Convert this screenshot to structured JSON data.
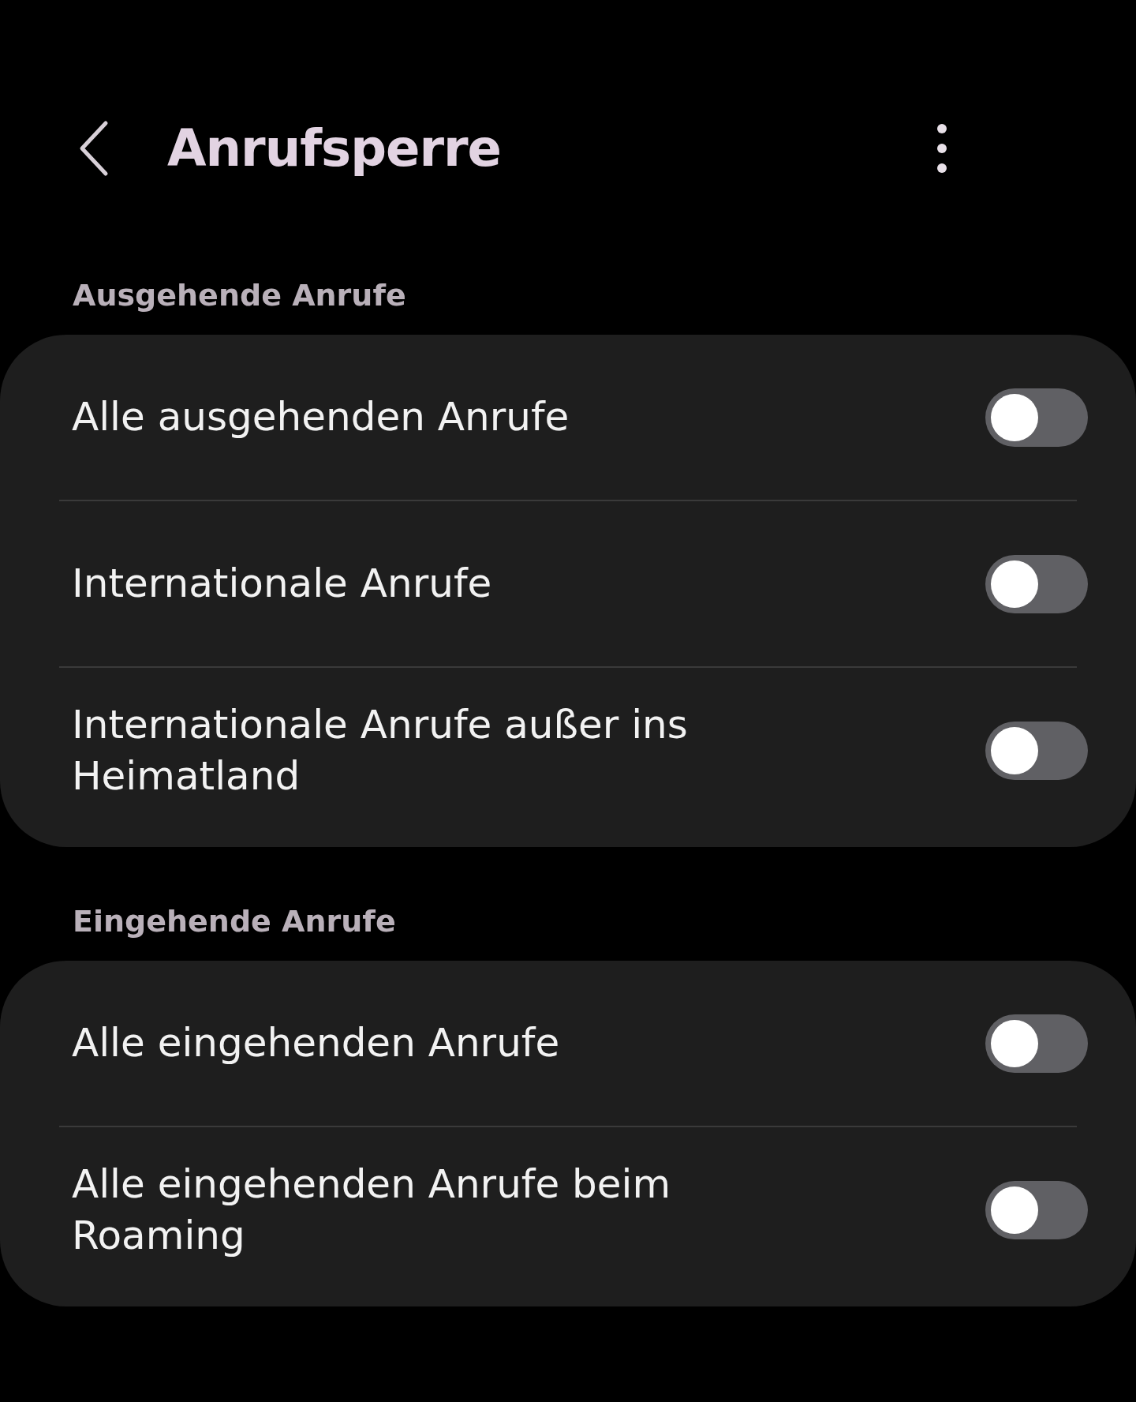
{
  "header": {
    "title": "Anrufsperre"
  },
  "sections": [
    {
      "title": "Ausgehende Anrufe",
      "items": [
        {
          "label": "Alle ausgehenden Anrufe",
          "on": false
        },
        {
          "label": "Internationale Anrufe",
          "on": false
        },
        {
          "label": "Internationale Anrufe außer ins Heimatland",
          "on": false
        }
      ]
    },
    {
      "title": "Eingehende Anrufe",
      "items": [
        {
          "label": "Alle eingehenden Anrufe",
          "on": false
        },
        {
          "label": "Alle eingehenden Anrufe beim Roaming",
          "on": false
        }
      ]
    }
  ]
}
